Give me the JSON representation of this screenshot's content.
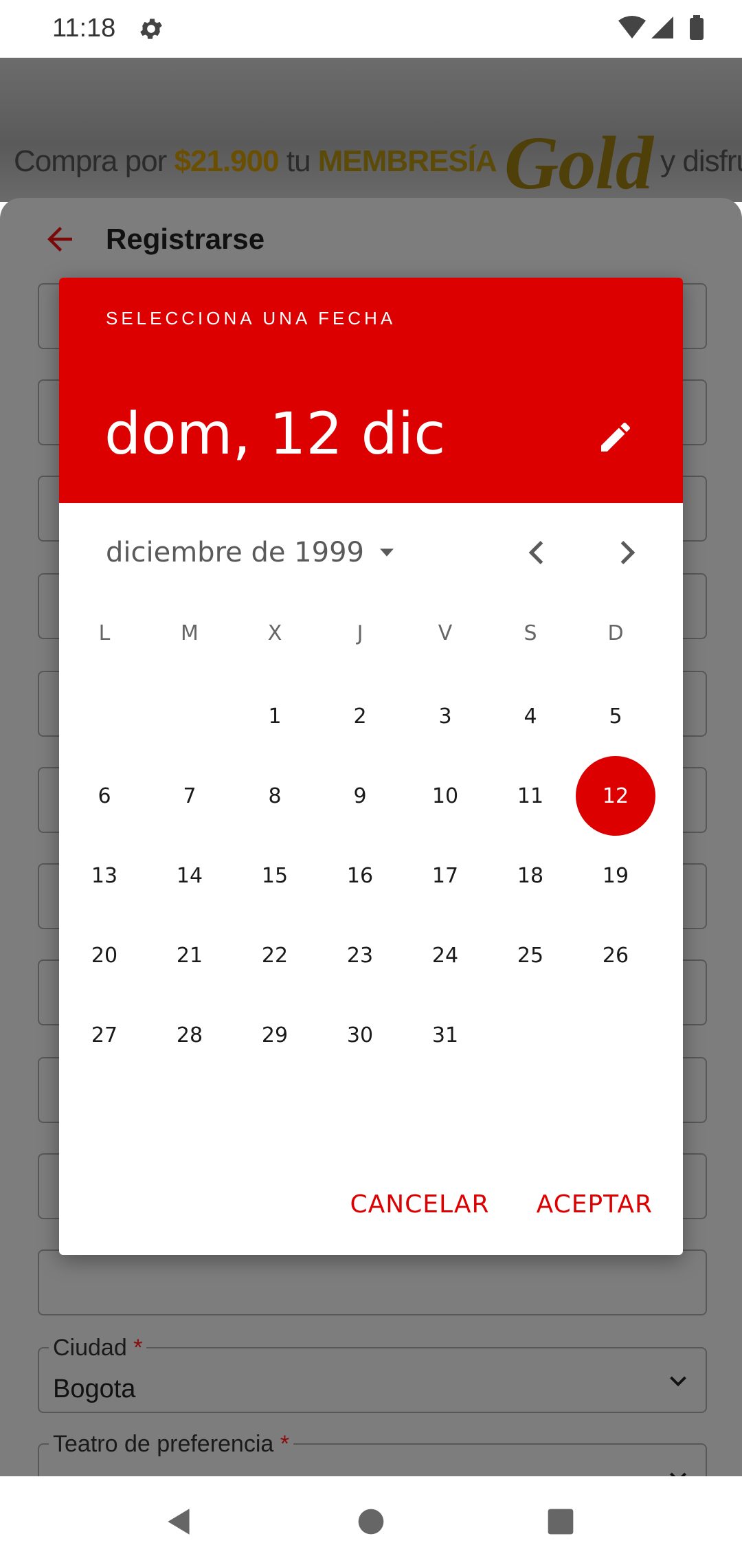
{
  "status_bar": {
    "time": "11:18",
    "icons": [
      "gear-icon",
      "wifi-icon",
      "signal-icon",
      "battery-icon"
    ]
  },
  "banner": {
    "prefix": "Compra por",
    "price": "$21.900",
    "mid": "tu",
    "membership": "MEMBRESÍA",
    "gold": "Gold",
    "suffix": "y disfruta un año de beneficios"
  },
  "register": {
    "title": "Registrarse",
    "fields": [
      {
        "label": "Ciudad",
        "required": "*",
        "value": "Bogota"
      },
      {
        "label": "Teatro de preferencia",
        "required": "*",
        "value": ""
      }
    ]
  },
  "date_picker": {
    "header_label": "SELECCIONA UNA FECHA",
    "selected_date": "dom, 12 dic",
    "month_label": "diciembre de 1999",
    "weekdays": [
      "L",
      "M",
      "X",
      "J",
      "V",
      "S",
      "D"
    ],
    "days": [
      "1",
      "2",
      "3",
      "4",
      "5",
      "6",
      "7",
      "8",
      "9",
      "10",
      "11",
      "12",
      "13",
      "14",
      "15",
      "16",
      "17",
      "18",
      "19",
      "20",
      "21",
      "22",
      "23",
      "24",
      "25",
      "26",
      "27",
      "28",
      "29",
      "30",
      "31"
    ],
    "selected_day": "12",
    "cancel_label": "CANCELAR",
    "accept_label": "ACEPTAR",
    "accent_color": "#dc0000"
  }
}
